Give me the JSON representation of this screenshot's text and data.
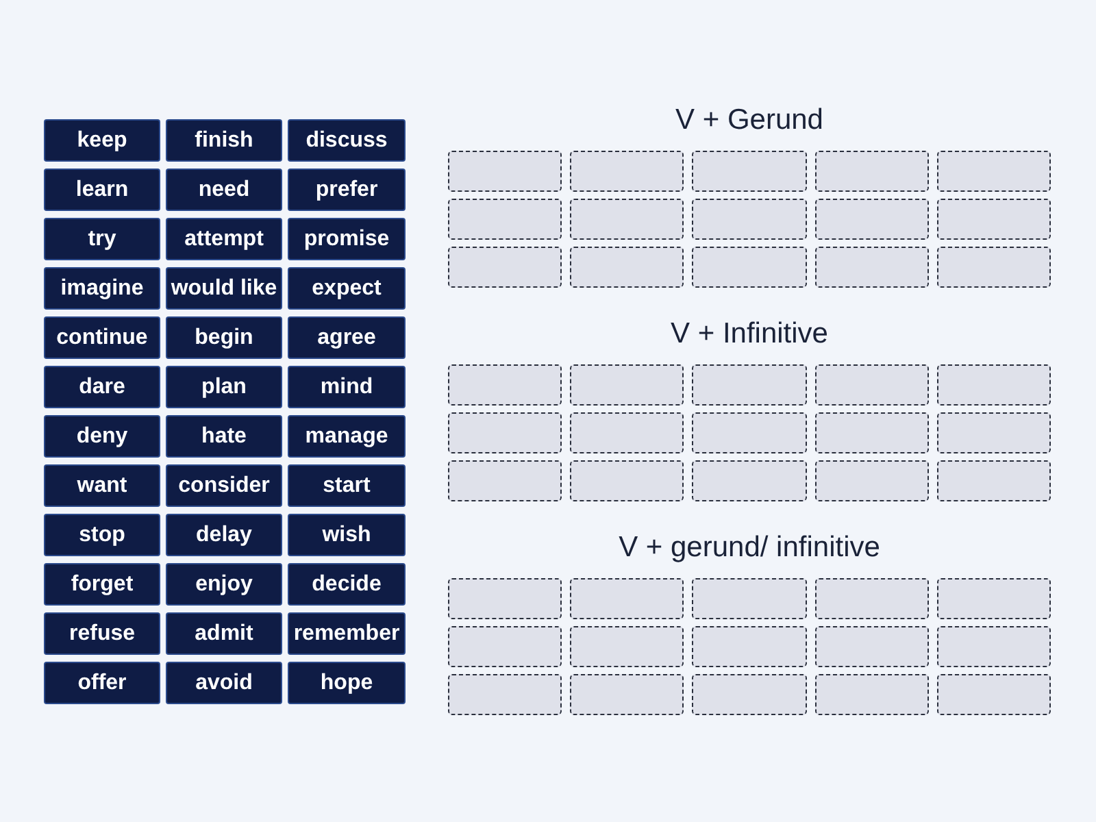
{
  "word_tiles": [
    "keep",
    "finish",
    "discuss",
    "learn",
    "need",
    "prefer",
    "try",
    "attempt",
    "promise",
    "imagine",
    "would like",
    "expect",
    "continue",
    "begin",
    "agree",
    "dare",
    "plan",
    "mind",
    "deny",
    "hate",
    "manage",
    "want",
    "consider",
    "start",
    "stop",
    "delay",
    "wish",
    "forget",
    "enjoy",
    "decide",
    "refuse",
    "admit",
    "remember",
    "offer",
    "avoid",
    "hope"
  ],
  "groups": [
    {
      "title": "V + Gerund"
    },
    {
      "title": "V + Infinitive"
    },
    {
      "title": "V + gerund/ infinitive"
    }
  ]
}
